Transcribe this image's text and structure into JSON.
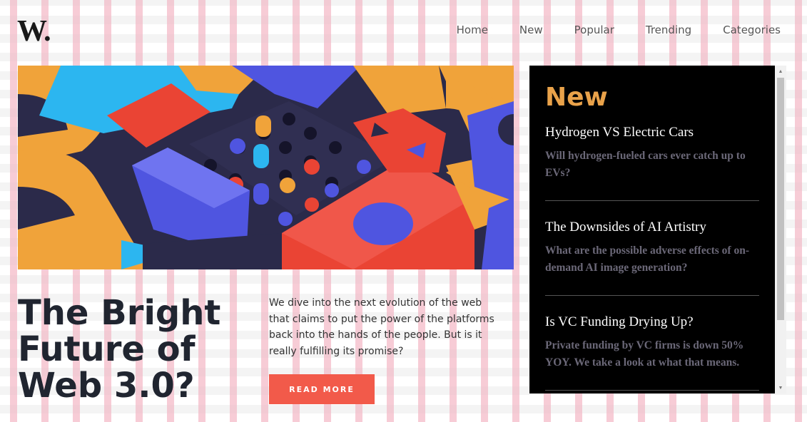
{
  "brand": {
    "logo": "W."
  },
  "nav": {
    "items": [
      "Home",
      "New",
      "Popular",
      "Trending",
      "Categories"
    ]
  },
  "hero": {
    "image_alt": "colorful 3D geometric blocks",
    "colors": {
      "orange": "#f0a33a",
      "blue": "#4f55e0",
      "cyan": "#2cb6f0",
      "red": "#ea4434",
      "navy": "#2b2a4a"
    }
  },
  "main": {
    "headline": "The Bright Future of Web 3.0?",
    "teaser": "We dive into the next evolution of the web that claims to put the power of the platforms back into the hands of the people. But is it really fulfilling its promise?",
    "cta_label": "READ MORE",
    "cta_color": "#f25a4a"
  },
  "sidebar": {
    "title": "New",
    "title_color": "#e9a24a",
    "articles": [
      {
        "title": "Hydrogen VS Electric Cars",
        "desc": "Will hydrogen-fueled cars ever catch up to EVs?"
      },
      {
        "title": "The Downsides of AI Artistry",
        "desc": "What are the possible adverse effects of on-demand AI image generation?"
      },
      {
        "title": "Is VC Funding Drying Up?",
        "desc": "Private funding by VC firms is down 50% YOY. We take a look at what that means."
      }
    ]
  }
}
